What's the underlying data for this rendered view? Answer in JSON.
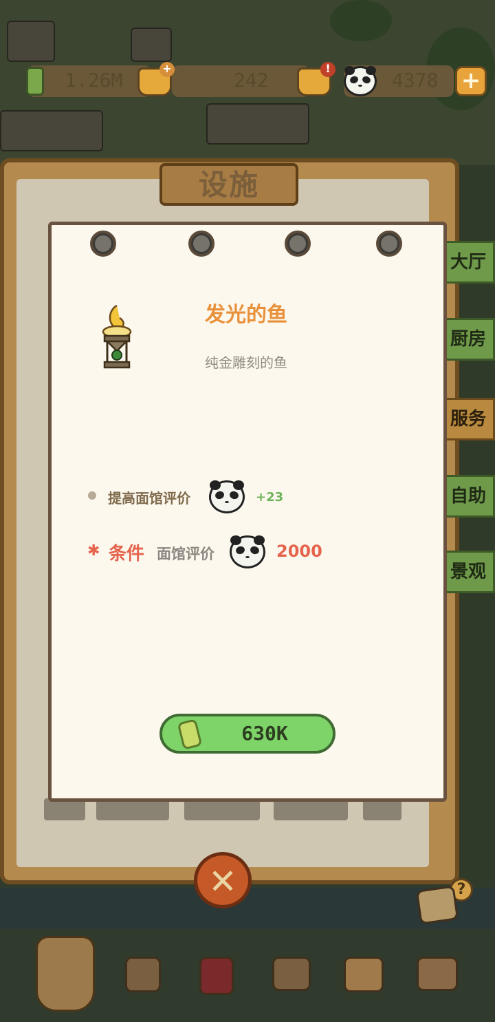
{
  "resources": {
    "bamboo_amount": "1.26M",
    "jar_amount": "242",
    "panda_amount": "4378"
  },
  "facility_panel": {
    "title": "设施",
    "side_tabs": [
      "大厅",
      "厨房",
      "服务",
      "自助",
      "景观"
    ],
    "active_tab": "服务"
  },
  "item": {
    "name": "发光的鱼",
    "description": "纯金雕刻的鱼",
    "bonus_label": "提高面馆评价",
    "bonus_value": "+23",
    "condition_label": "条件",
    "condition_sub": "面馆评价",
    "condition_value": "2000",
    "price": "630K"
  },
  "colors": {
    "item_name": "#e8913a",
    "condition": "#e5644d",
    "bonus": "#6db35a",
    "buy_button": "#7ed468"
  },
  "icons": {
    "bamboo": "bamboo-icon",
    "panda": "panda-icon",
    "close": "close-icon",
    "help": "help-icon"
  }
}
